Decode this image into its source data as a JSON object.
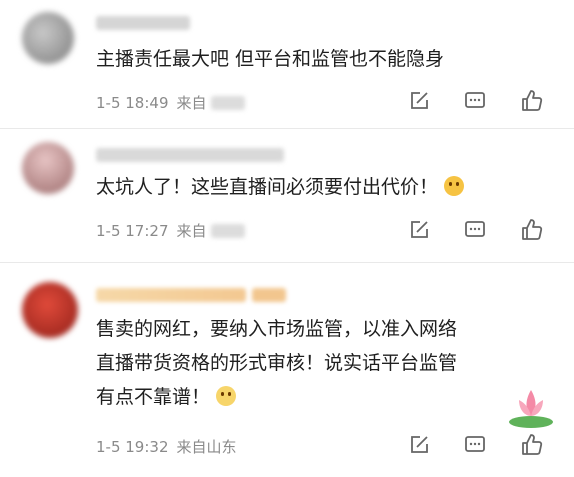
{
  "comments": [
    {
      "text": "主播责任最大吧 但平台和监管也不能隐身",
      "time": "1-5 18:49",
      "location_prefix": "来自",
      "location": ""
    },
    {
      "text": "太坑人了！这些直播间必须要付出代价！",
      "time": "1-5 17:27",
      "location_prefix": "来自",
      "location": ""
    },
    {
      "lines": [
        "售卖的网红，要纳入市场监管，以准入网络",
        "直播带货资格的形式审核！说实话平台监管",
        "有点不靠谱！"
      ],
      "time": "1-5 19:32",
      "location_prefix": "来自",
      "location": "山东"
    }
  ],
  "icons": {
    "share": "edit-share-icon",
    "comment": "comment-icon",
    "like": "thumbs-up-icon"
  }
}
